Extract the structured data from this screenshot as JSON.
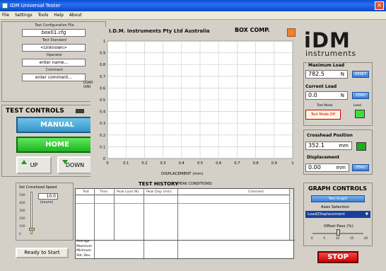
{
  "window": {
    "title": "IDM Universal Tester"
  },
  "menu": [
    "File",
    "Settings",
    "Tools",
    "Help",
    "About"
  ],
  "left": {
    "test_config_label": "Test Configuration File",
    "test_config_value": "box01.cfg",
    "test_standard_label": "Test Standard",
    "test_standard_value": "<Unknown>",
    "operator_label": "Operator",
    "operator_value": "enter name...",
    "comment_label": "Comment",
    "comment_value": "enter comment..."
  },
  "test_controls": {
    "title": "TEST CONTROLS",
    "manual": "MANUAL",
    "home": "HOME",
    "up": "UP",
    "down": "DOWN"
  },
  "speed": {
    "label": "Set Crosshead Speed",
    "value": "10.0",
    "unit": "[mm/m]",
    "scale": [
      "500",
      "400",
      "300",
      "200",
      "100",
      "0"
    ]
  },
  "ready": "Ready to Start",
  "chart": {
    "title": "I.D.M. Instruments Pty Ltd  Australia",
    "box_comp": "BOX COMP."
  },
  "chart_data": {
    "type": "line",
    "series": [],
    "xlabel": "DISPLACEMENT (mm)",
    "ylabel": "LOAD (kN)",
    "xlim": [
      0,
      1
    ],
    "ylim": [
      0,
      1
    ],
    "xticks": [
      "0",
      "0.1",
      "0.2",
      "0.3",
      "0.4",
      "0.5",
      "0.6",
      "0.7",
      "0.8",
      "0.9",
      "1"
    ],
    "yticks": [
      "0",
      "0.1",
      "0.2",
      "0.3",
      "0.4",
      "0.5",
      "0.6",
      "0.7",
      "0.8",
      "0.9",
      "1"
    ],
    "grid": true
  },
  "logo": {
    "main": "iDM",
    "sub": "instruments"
  },
  "max_load": {
    "label": "Maximum Load",
    "value": "782.5",
    "unit": "N",
    "reset": "RESET"
  },
  "current_load": {
    "label": "Current Load",
    "value": "0.0",
    "unit": "N",
    "zero": "ZERO",
    "test_mode_label": "Test Mode",
    "test_mode_value": "Test Mode Off",
    "led_label": "Load"
  },
  "crosshead": {
    "label": "Crosshead Position",
    "value": "352.1",
    "unit": "mm",
    "disp_label": "Displacement",
    "disp_value": "0.00",
    "disp_unit": "mm",
    "zero": "ZERO"
  },
  "graph_controls": {
    "title": "GRAPH CONTROLS",
    "test_graph": "Test Graph",
    "axes_label": "Axes Selection",
    "axes_value": "Load/Displacement",
    "offset_label": "Offset Pass (%)",
    "offset_ticks": [
      "0",
      "5",
      "10",
      "15",
      "20"
    ],
    "offset_value": 10
  },
  "stop": "STOP",
  "history": {
    "title": "TEST HISTORY",
    "subtitle": "(PEAK CONDITIONS)",
    "columns": [
      "Test",
      "Time",
      "Peak Load (N)",
      "Peak Disp (mm)",
      "Comment"
    ],
    "footer": [
      "Average",
      "Maximum",
      "Minimum",
      "Std. Dev."
    ]
  },
  "colors": {
    "plot_bg": "#ffffff",
    "grid": "#c8c8c8",
    "manual": "#3796c8",
    "home": "#20b420",
    "stop": "#cc0000"
  }
}
